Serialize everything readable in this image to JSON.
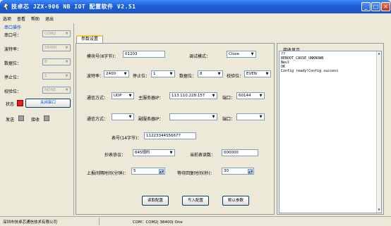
{
  "window": {
    "title": "技卓芯 JZX-906 NB IOT 配置软件  V2.51"
  },
  "menu": [
    "选项",
    "查看",
    "帮助",
    "退出"
  ],
  "serial": {
    "group_title": "串口操作",
    "port_label": "串口号：",
    "port_value": "COM2",
    "baud_label": "波特率：",
    "baud_value": "38400",
    "databits_label": "数据位：",
    "databits_value": "8",
    "stopbits_label": "停止位：",
    "stopbits_value": "1",
    "parity_label": "校验位：",
    "parity_value": "NONE",
    "status_label": "状态",
    "close_port_label": "关闭串口",
    "send_label": "发送",
    "receive_label": "接收",
    "status_color": "#e0201c"
  },
  "tab": {
    "label": "参数设置"
  },
  "params": {
    "module_id_label": "模块号(8字节)：",
    "module_id_value": "01203",
    "debug_mode_label": "调试模式：",
    "debug_mode_value": "Close",
    "baud_label": "波特率：",
    "baud_value": "2400",
    "stop_label": "停止位：",
    "stop_value": "1",
    "data_label": "数据位：",
    "data_value": "8",
    "parity_label": "校验位：",
    "parity_value": "EVEN",
    "comm_label": "通信方式：",
    "comm_value": "UDP",
    "main_server_label": "主服务器IP：",
    "main_server_value": "113.110.228.157",
    "port_label": "端口：",
    "port_value": "60144",
    "comm2_label": "通信方式：",
    "comm2_value": "",
    "backup_server_label": "副服务器IP：",
    "backup_server_value": "",
    "port2_label": "端口：",
    "port2_value": "",
    "meter_no_label": "表号(14字节)：",
    "meter_no_value": "11223344556677",
    "protocol_label": "抄表协议：",
    "protocol_value": "645规约",
    "current_reading_label": "当前表读数：",
    "current_reading_value": "000000",
    "upload_interval_label": "上报间隔时间(分钟)：",
    "upload_interval_value": "5",
    "wait_time_label": "等待回复时间(秒)：",
    "wait_time_value": "30",
    "read_button": "读取配置",
    "write_button": "写入配置",
    "default_button": "默认参数"
  },
  "receive": {
    "title": "接收显示",
    "lines": [
      "??",
      "REBOOT_CAUSE_UNKNOWN",
      "Neul",
      "OK",
      "Config ready!Config success"
    ]
  },
  "statusbar": {
    "company": "深圳市技卓芯通信技术有限公司",
    "port_info": "COM：COM2| 38400| One"
  }
}
